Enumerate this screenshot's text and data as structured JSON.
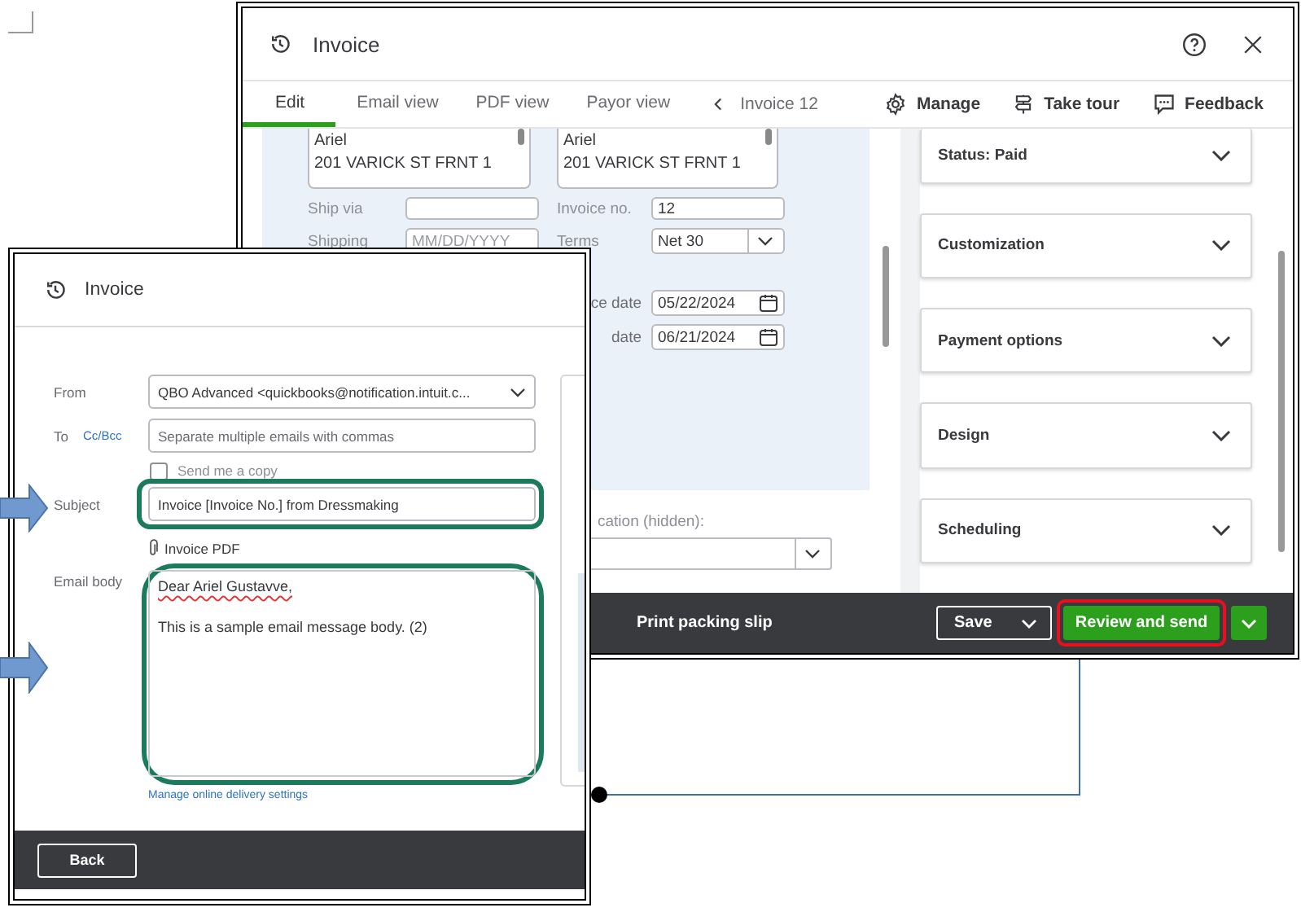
{
  "back_window": {
    "title": "Invoice",
    "tabs": [
      {
        "label": "Edit",
        "selected": true
      },
      {
        "label": "Email view",
        "selected": false
      },
      {
        "label": "PDF view",
        "selected": false
      },
      {
        "label": "Payor view",
        "selected": false
      }
    ],
    "record_nav": "Invoice 12",
    "actions": [
      {
        "label": "Manage",
        "kind": "gear"
      },
      {
        "label": "Take tour",
        "kind": "signpost"
      },
      {
        "label": "Feedback",
        "kind": "chat"
      }
    ],
    "addresses": [
      {
        "lines": [
          "Ariel",
          "201 VARICK ST FRNT 1"
        ]
      },
      {
        "lines": [
          "Ariel",
          "201 VARICK ST FRNT 1"
        ]
      }
    ],
    "ship_via": {
      "label": "Ship via"
    },
    "shipping_date": {
      "label": "Shipping",
      "placeholder": "MM/DD/YYYY"
    },
    "invoice_no": {
      "label": "Invoice no.",
      "value": "12"
    },
    "terms": {
      "label": "Terms",
      "value": "Net 30"
    },
    "invoice_date": {
      "label": "ce date",
      "value": "05/22/2024"
    },
    "due_date": {
      "label": "date",
      "value": "06/21/2024"
    },
    "location": {
      "label": "cation (hidden):"
    },
    "sections": [
      {
        "label": "Status: Paid",
        "expanded": false
      },
      {
        "label": "Customization",
        "expanded": false
      },
      {
        "label": "Payment options",
        "expanded": false
      },
      {
        "label": "Design",
        "expanded": false
      },
      {
        "label": "Scheduling",
        "expanded": false
      }
    ],
    "footer": {
      "print": "Print packing slip",
      "save": "Save",
      "primary": {
        "label": "Review and send",
        "highlighted": true
      }
    }
  },
  "front_window": {
    "title": "Invoice",
    "from": {
      "label": "From",
      "value": "QBO Advanced <quickbooks@notification.intuit.c..."
    },
    "to": {
      "label": "To",
      "link": "Cc/Bcc",
      "placeholder": "Separate multiple emails with commas"
    },
    "copy": {
      "label": "Send me a copy",
      "checked": false
    },
    "subject": {
      "label": "Subject",
      "value": "Invoice [Invoice No.] from Dressmaking",
      "highlighted": true,
      "pointer": true
    },
    "attachment": "Invoice PDF",
    "body": {
      "label": "Email body",
      "paragraphs": [
        "Dear Ariel Gustavve,",
        "This is a sample email message body. (2)"
      ],
      "highlighted": true,
      "pointer": true
    },
    "manage_link": "Manage online delivery settings",
    "back": "Back"
  }
}
